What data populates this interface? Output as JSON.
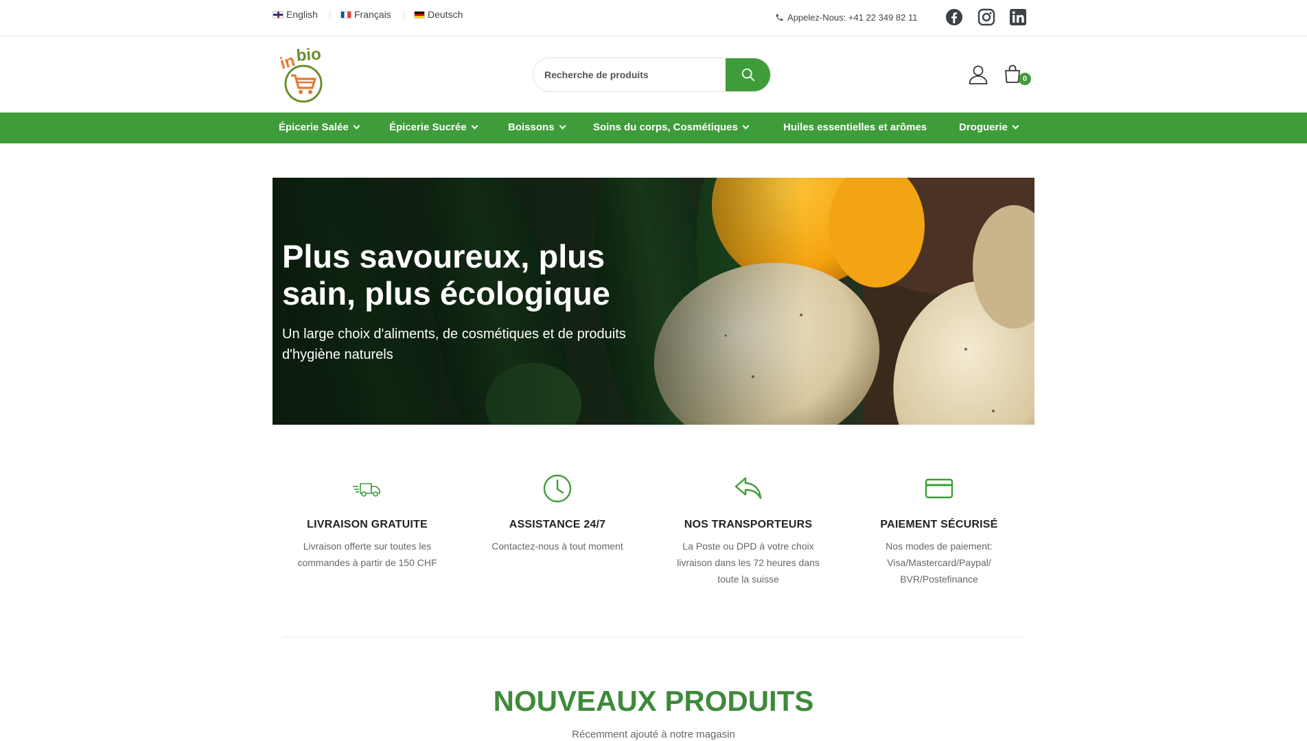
{
  "topbar": {
    "languages": [
      {
        "label": "English"
      },
      {
        "label": "Français"
      },
      {
        "label": "Deutsch"
      }
    ],
    "phone": "Appelez-Nous: +41 22 349 82 11",
    "social": [
      "facebook-icon",
      "instagram-icon",
      "linkedin-icon"
    ]
  },
  "header": {
    "logo_text": "inbio",
    "search_placeholder": "Recherche de produits",
    "cart_count": "0"
  },
  "nav": {
    "items": [
      {
        "label": "Épicerie Salée",
        "dropdown": true
      },
      {
        "label": "Épicerie Sucrée",
        "dropdown": true
      },
      {
        "label": "Boissons",
        "dropdown": true
      },
      {
        "label": "Soins du corps, Cosmétiques",
        "dropdown": true
      },
      {
        "label": "Huiles essentielles et arômes",
        "dropdown": false
      },
      {
        "label": "Droguerie",
        "dropdown": true
      }
    ]
  },
  "hero": {
    "title": "Plus savoureux, plus sain, plus écologique",
    "subtitle": "Un large choix d'aliments, de cosmétiques et de produits d'hygiène naturels"
  },
  "features": [
    {
      "icon": "delivery-truck-icon",
      "title": "LIVRAISON GRATUITE",
      "text": "Livraison offerte sur toutes les commandes à partir de 150 CHF"
    },
    {
      "icon": "clock-icon",
      "title": "ASSISTANCE 24/7",
      "text": "Contactez-nous à tout moment"
    },
    {
      "icon": "reply-arrow-icon",
      "title": "NOS TRANSPORTEURS",
      "text": "La Poste ou DPD à votre choix livraison dans les 72 heures dans toute la suisse"
    },
    {
      "icon": "credit-card-icon",
      "title": "PAIEMENT SÉCURISÉ",
      "text": "Nos modes de paiement: Visa/Mastercard/Paypal/ BVR/Postefinance"
    }
  ],
  "new_products": {
    "title": "NOUVEAUX PRODUITS",
    "subtitle": "Récemment ajouté à notre magasin"
  },
  "colors": {
    "brand_green": "#3f9c3a",
    "title_green": "#3f8a3a",
    "logo_orange": "#e8772e"
  }
}
